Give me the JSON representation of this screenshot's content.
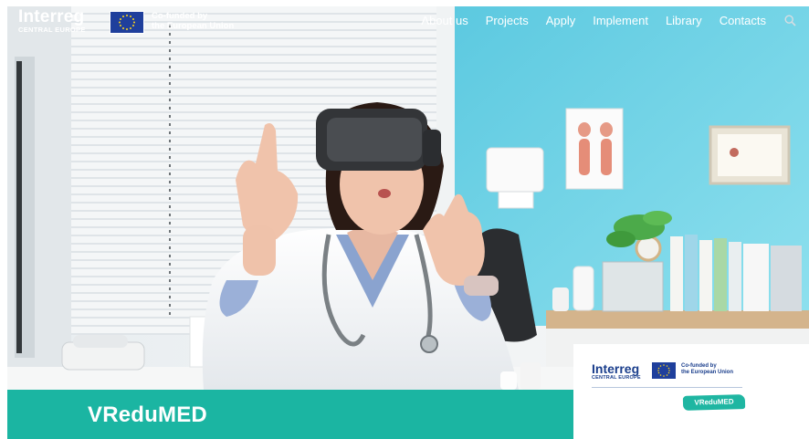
{
  "header": {
    "logo_word": "Interreg",
    "logo_sub": "CENTRAL EUROPE",
    "eu_line1": "Co-funded by",
    "eu_line2": "the European Union",
    "search_icon": "search-icon"
  },
  "nav": {
    "items": [
      {
        "label": "About us"
      },
      {
        "label": "Projects"
      },
      {
        "label": "Apply"
      },
      {
        "label": "Implement"
      },
      {
        "label": "Library"
      },
      {
        "label": "Contacts"
      }
    ]
  },
  "card": {
    "logo_word": "Interreg",
    "logo_sub": "CENTRAL EUROPE",
    "eu_line1": "Co-funded by",
    "eu_line2": "the European Union",
    "badge": "VReduMED"
  },
  "band": {
    "title": "VReduMED"
  },
  "colors": {
    "accent_teal": "#1bb5a2",
    "brand_blue": "#1a3e8c",
    "eu_blue": "#1f3f9c",
    "wall_blue": "#6fd6ea"
  }
}
